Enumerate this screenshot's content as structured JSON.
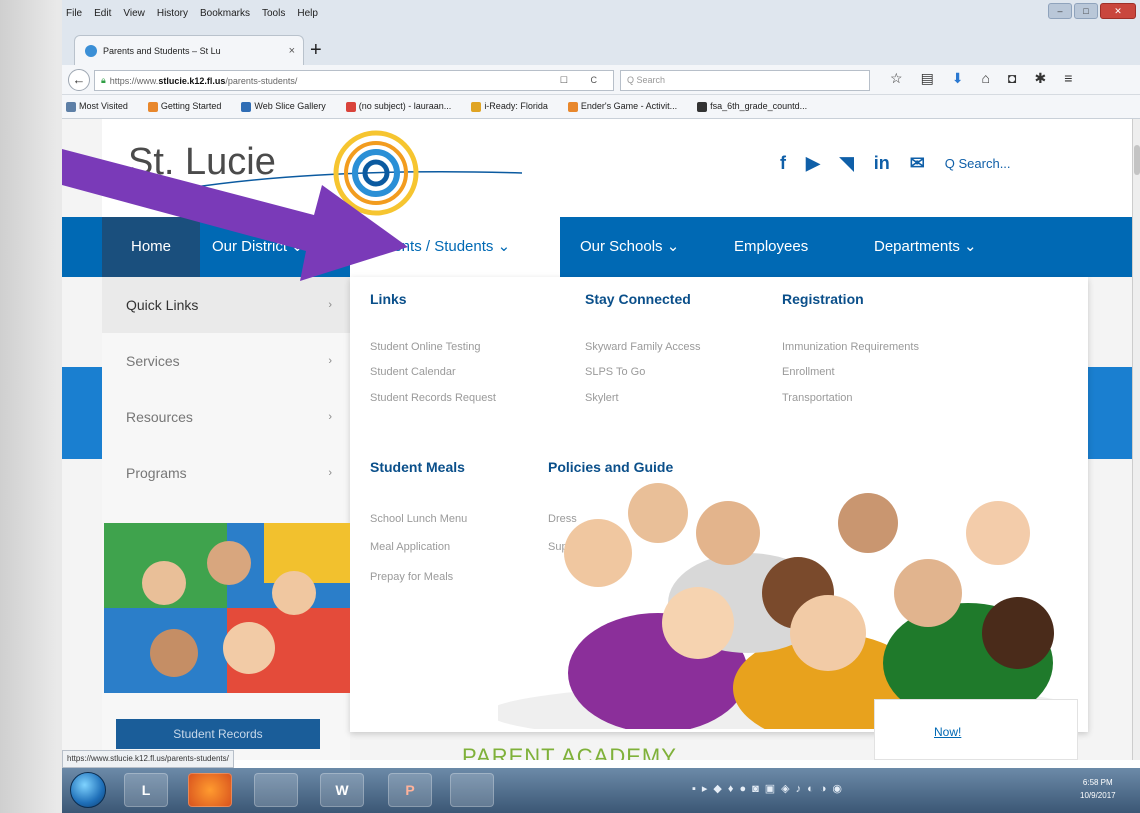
{
  "menubar": {
    "items": [
      "File",
      "Edit",
      "View",
      "History",
      "Bookmarks",
      "Tools",
      "Help"
    ]
  },
  "tab": {
    "title": "Parents and Students – St Lu",
    "close": "×",
    "new_tab": "+"
  },
  "navbar": {
    "back": "←",
    "url_prefix": "https://www.",
    "url_domain": "stlucie.k12.fl.us",
    "url_path": "/parents-students/",
    "url_icons": "☐ C",
    "search_placeholder": "Q Search"
  },
  "bookmarks": [
    {
      "label": "Most Visited",
      "color": "#5d7fa6"
    },
    {
      "label": "Getting Started",
      "color": "#e8872c"
    },
    {
      "label": "Web Slice Gallery",
      "color": "#2f6db5"
    },
    {
      "label": "(no subject) - lauraan...",
      "color": "#d9433b"
    },
    {
      "label": "i-Ready: Florida",
      "color": "#e0a423"
    },
    {
      "label": "Ender's Game - Activit...",
      "color": "#e8872c"
    },
    {
      "label": "fsa_6th_grade_countd...",
      "color": "#333333"
    }
  ],
  "site": {
    "logo": "St. Lucie",
    "search": "Q Search...",
    "nav": {
      "home": "Home",
      "district": "Our District ⌄",
      "parents": "Parents / Students ⌄",
      "schools": "Our Schools ⌄",
      "employees": "Employees",
      "departments": "Departments ⌄"
    },
    "left_menu": [
      {
        "label": "Quick Links",
        "chev": "›"
      },
      {
        "label": "Services",
        "chev": "›"
      },
      {
        "label": "Resources",
        "chev": "›"
      },
      {
        "label": "Programs",
        "chev": "›"
      }
    ],
    "dropdown": {
      "links_head": "Links",
      "links": [
        "Student Online Testing",
        "Student Calendar",
        "Student Records Request"
      ],
      "connected_head": "Stay Connected",
      "connected": [
        "Skyward Family Access",
        "SLPS To Go",
        "Skylert"
      ],
      "registration_head": "Registration",
      "registration": [
        "Immunization Requirements",
        "Enrollment",
        "Transportation"
      ],
      "meals_head": "Student Meals",
      "meals": [
        "School Lunch Menu",
        "Meal Application",
        "Prepay for Meals"
      ],
      "policies_head": "Policies and Guide",
      "policies": [
        "Dress",
        "Sup"
      ]
    },
    "bottom_button": "Student Records",
    "academy": "PARENT ACADEMY",
    "now_link": "Now!"
  },
  "status_url": "https://www.stlucie.k12.fl.us/parents-students/",
  "taskbar": {
    "time": "6:58 PM",
    "date": "10/9/2017",
    "buttons": [
      "L",
      "",
      "",
      "W",
      "P",
      ""
    ]
  },
  "colors": {
    "nav_blue": "#0069b4",
    "heading_blue": "#0a4f8a",
    "arrow_purple": "#7a3ab8",
    "academy_green": "#7fb13a"
  }
}
